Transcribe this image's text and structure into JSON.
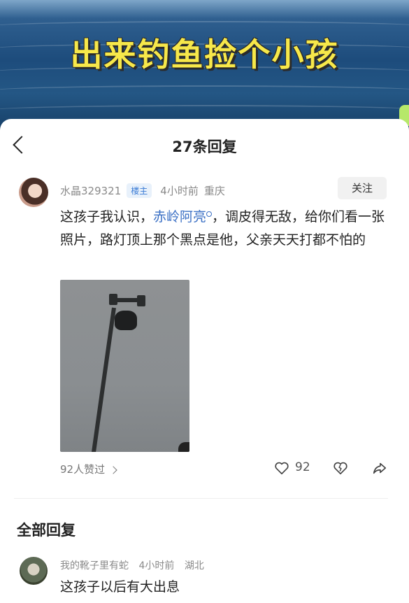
{
  "video": {
    "caption": "出来钓鱼捡个小孩"
  },
  "header": {
    "title": "27条回复"
  },
  "post": {
    "username": "水晶329321",
    "badge": "楼主",
    "time": "4小时前",
    "location": "重庆",
    "follow_label": "关注",
    "text_before": "这孩子我认识，",
    "mention": "赤岭阿亮",
    "text_after": "，调皮得无敌，给你们看一张照片，路灯顶上那个黑点是他，父亲天天打都不怕的",
    "likes_label": "92人赞过",
    "like_count": "92"
  },
  "section": {
    "title": "全部回复"
  },
  "reply": {
    "username": "我的靴子里有蛇",
    "time": "4小时前",
    "location": "湖北",
    "text": "这孩子以后有大出息"
  }
}
